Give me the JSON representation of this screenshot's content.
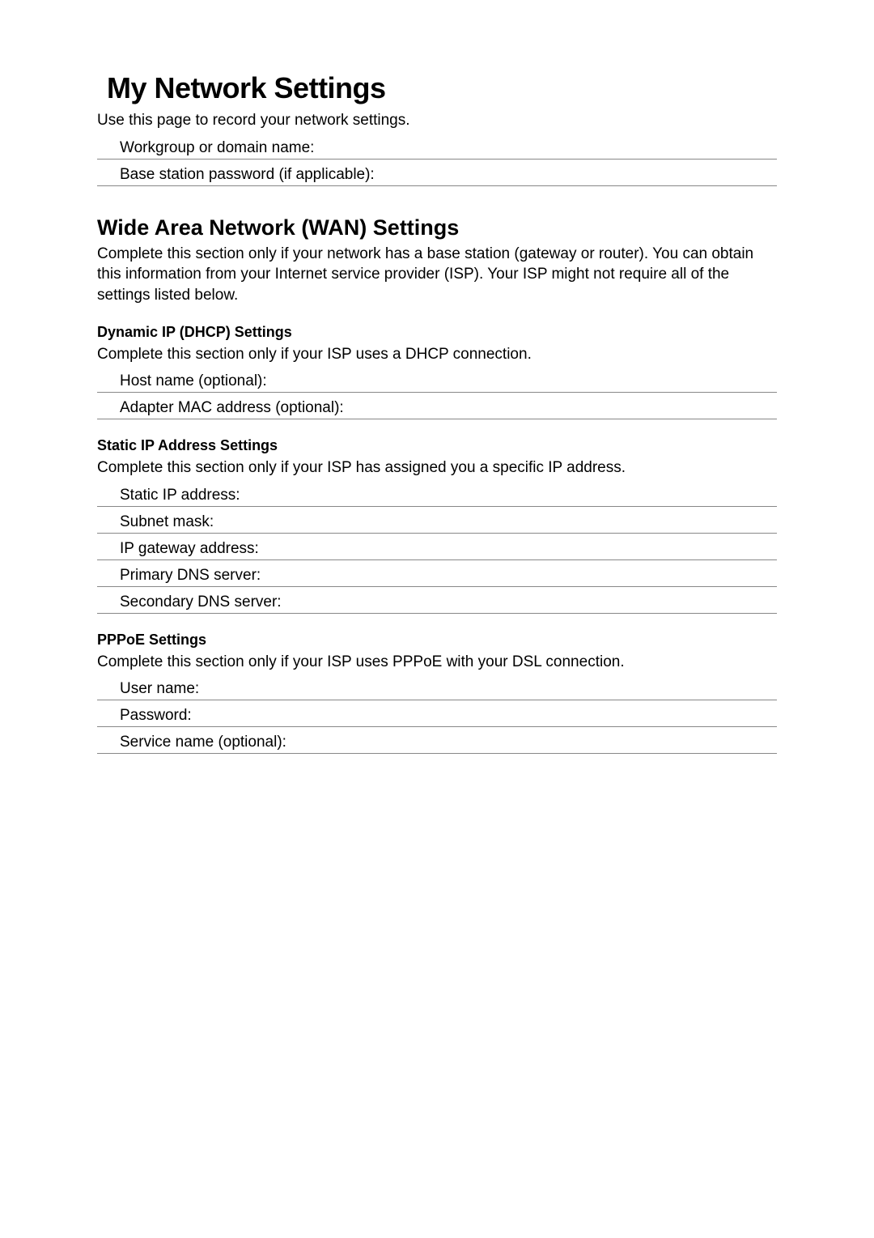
{
  "page": {
    "title": "My Network Settings",
    "description": "Use this page to record your network settings."
  },
  "topFields": [
    {
      "label": "Workgroup or domain name:",
      "value": ""
    },
    {
      "label": "Base station password (if applicable):",
      "value": ""
    }
  ],
  "wan": {
    "title": "Wide Area Network (WAN) Settings",
    "description": "Complete this section only if your network has a base station (gateway or router). You can obtain this information from your Internet service provider (ISP). Your ISP might not require all of the settings listed below."
  },
  "dhcp": {
    "title": "Dynamic IP (DHCP) Settings",
    "description": "Complete this section only if your ISP uses a DHCP connection.",
    "fields": [
      {
        "label": "Host name (optional):",
        "value": ""
      },
      {
        "label": "Adapter MAC address (optional):",
        "value": ""
      }
    ]
  },
  "staticip": {
    "title": "Static IP Address Settings",
    "description": "Complete this section only if your ISP has assigned you a specific IP address.",
    "fields": [
      {
        "label": "Static IP address:",
        "value": ""
      },
      {
        "label": "Subnet mask:",
        "value": ""
      },
      {
        "label": "IP gateway address:",
        "value": ""
      },
      {
        "label": "Primary DNS server:",
        "value": ""
      },
      {
        "label": "Secondary DNS server:",
        "value": ""
      }
    ]
  },
  "pppoe": {
    "title": "PPPoE Settings",
    "description": "Complete this section only if your ISP uses PPPoE with your DSL connection.",
    "fields": [
      {
        "label": "User name:",
        "value": ""
      },
      {
        "label": "Password:",
        "value": ""
      },
      {
        "label": "Service name (optional):",
        "value": ""
      }
    ]
  }
}
